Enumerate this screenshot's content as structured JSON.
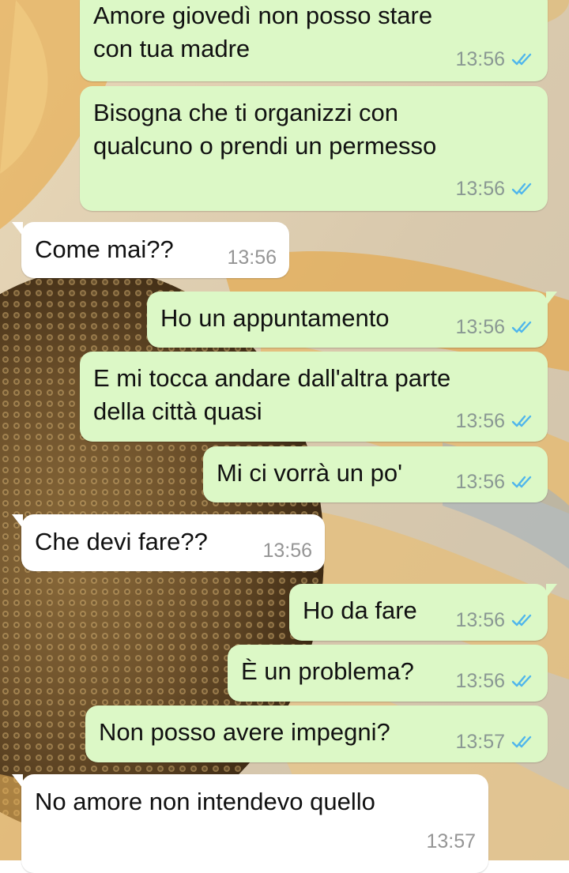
{
  "chat": {
    "messages": [
      {
        "direction": "out",
        "lines": [
          "Amore giovedì non posso stare",
          "con tua madre"
        ],
        "time": "13:56",
        "status": "read-double-check"
      },
      {
        "direction": "out",
        "lines": [
          "Bisogna che ti organizzi con",
          "qualcuno o prendi un permesso"
        ],
        "time": "13:56",
        "status": "read-double-check"
      },
      {
        "direction": "in",
        "lines": [
          "Come mai??"
        ],
        "time": "13:56"
      },
      {
        "direction": "out",
        "lines": [
          "Ho un appuntamento"
        ],
        "time": "13:56",
        "status": "read-double-check"
      },
      {
        "direction": "out",
        "lines": [
          "E mi tocca andare dall'altra parte",
          "della città quasi"
        ],
        "time": "13:56",
        "status": "read-double-check"
      },
      {
        "direction": "out",
        "lines": [
          "Mi ci vorrà un po'"
        ],
        "time": "13:56",
        "status": "read-double-check"
      },
      {
        "direction": "in",
        "lines": [
          "Che devi fare??"
        ],
        "time": "13:56"
      },
      {
        "direction": "out",
        "lines": [
          "Ho da fare"
        ],
        "time": "13:56",
        "status": "read-double-check"
      },
      {
        "direction": "out",
        "lines": [
          "È un problema?"
        ],
        "time": "13:56",
        "status": "read-double-check"
      },
      {
        "direction": "out",
        "lines": [
          "Non posso avere impegni?"
        ],
        "time": "13:57",
        "status": "read-double-check"
      },
      {
        "direction": "in",
        "lines": [
          "No amore non intendevo quello"
        ],
        "time": "13:57"
      }
    ]
  },
  "colors": {
    "outgoing_bubble": "#dcf8c6",
    "incoming_bubble": "#ffffff",
    "read_ticks": "#4fb6ec",
    "timestamp": "#8a9893"
  },
  "icons": {
    "read_status": "double-check-icon",
    "wallpaper": "sunflower-wallpaper"
  }
}
